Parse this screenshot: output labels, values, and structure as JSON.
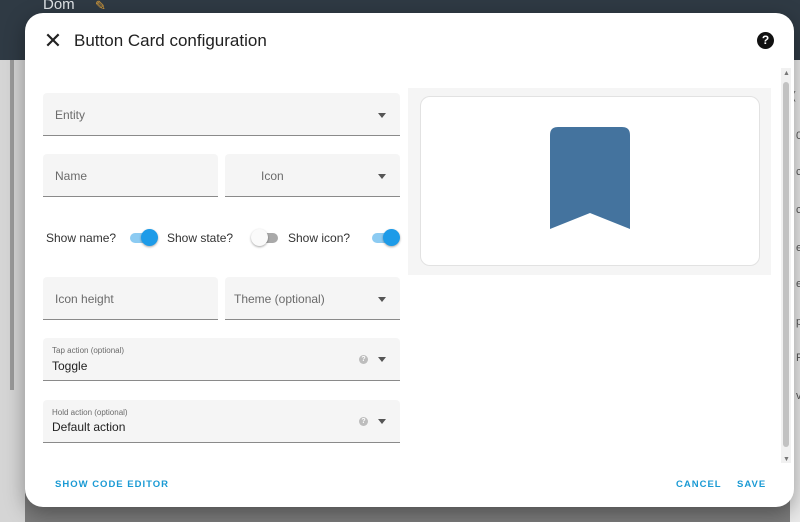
{
  "background": {
    "header_title": "Dom",
    "side_letters": [
      "(",
      "0",
      "c",
      "c",
      "e",
      "e",
      "p",
      "F",
      "v"
    ]
  },
  "dialog": {
    "title": "Button Card configuration",
    "help_label": "?"
  },
  "form": {
    "entity": {
      "label": "Entity",
      "value": ""
    },
    "name": {
      "label": "Name",
      "value": ""
    },
    "icon": {
      "label": "Icon",
      "value": ""
    },
    "toggles": {
      "show_name": {
        "label": "Show name?",
        "on": true
      },
      "show_state": {
        "label": "Show state?",
        "on": false
      },
      "show_icon": {
        "label": "Show icon?",
        "on": true
      }
    },
    "icon_height": {
      "label": "Icon height",
      "value": ""
    },
    "theme": {
      "label": "Theme (optional)",
      "value": ""
    },
    "tap_action": {
      "label": "Tap action (optional)",
      "value": "Toggle"
    },
    "hold_action": {
      "label": "Hold action (optional)",
      "value": "Default action"
    }
  },
  "preview": {
    "icon": "bookmark-icon",
    "icon_color": "#44739e"
  },
  "footer": {
    "show_code_editor": "SHOW CODE EDITOR",
    "cancel": "CANCEL",
    "save": "SAVE"
  },
  "colors": {
    "accent": "#1a9ad4",
    "switch_on": "#1d9be8"
  }
}
